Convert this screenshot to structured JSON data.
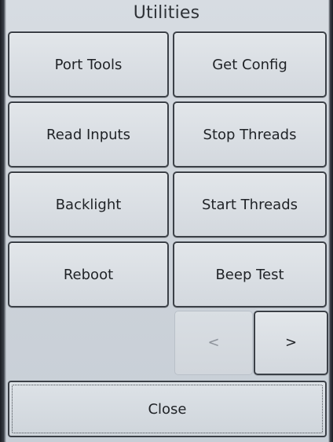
{
  "screen": {
    "title": "Utilities"
  },
  "buttons": {
    "port_tools": "Port Tools",
    "get_config": "Get Config",
    "read_inputs": "Read Inputs",
    "stop_threads": "Stop Threads",
    "backlight": "Backlight",
    "start_threads": "Start Threads",
    "reboot": "Reboot",
    "beep_test": "Beep Test"
  },
  "pager": {
    "prev_glyph": "<",
    "next_glyph": ">",
    "prev_enabled": false,
    "next_enabled": true
  },
  "footer": {
    "close_label": "Close"
  }
}
